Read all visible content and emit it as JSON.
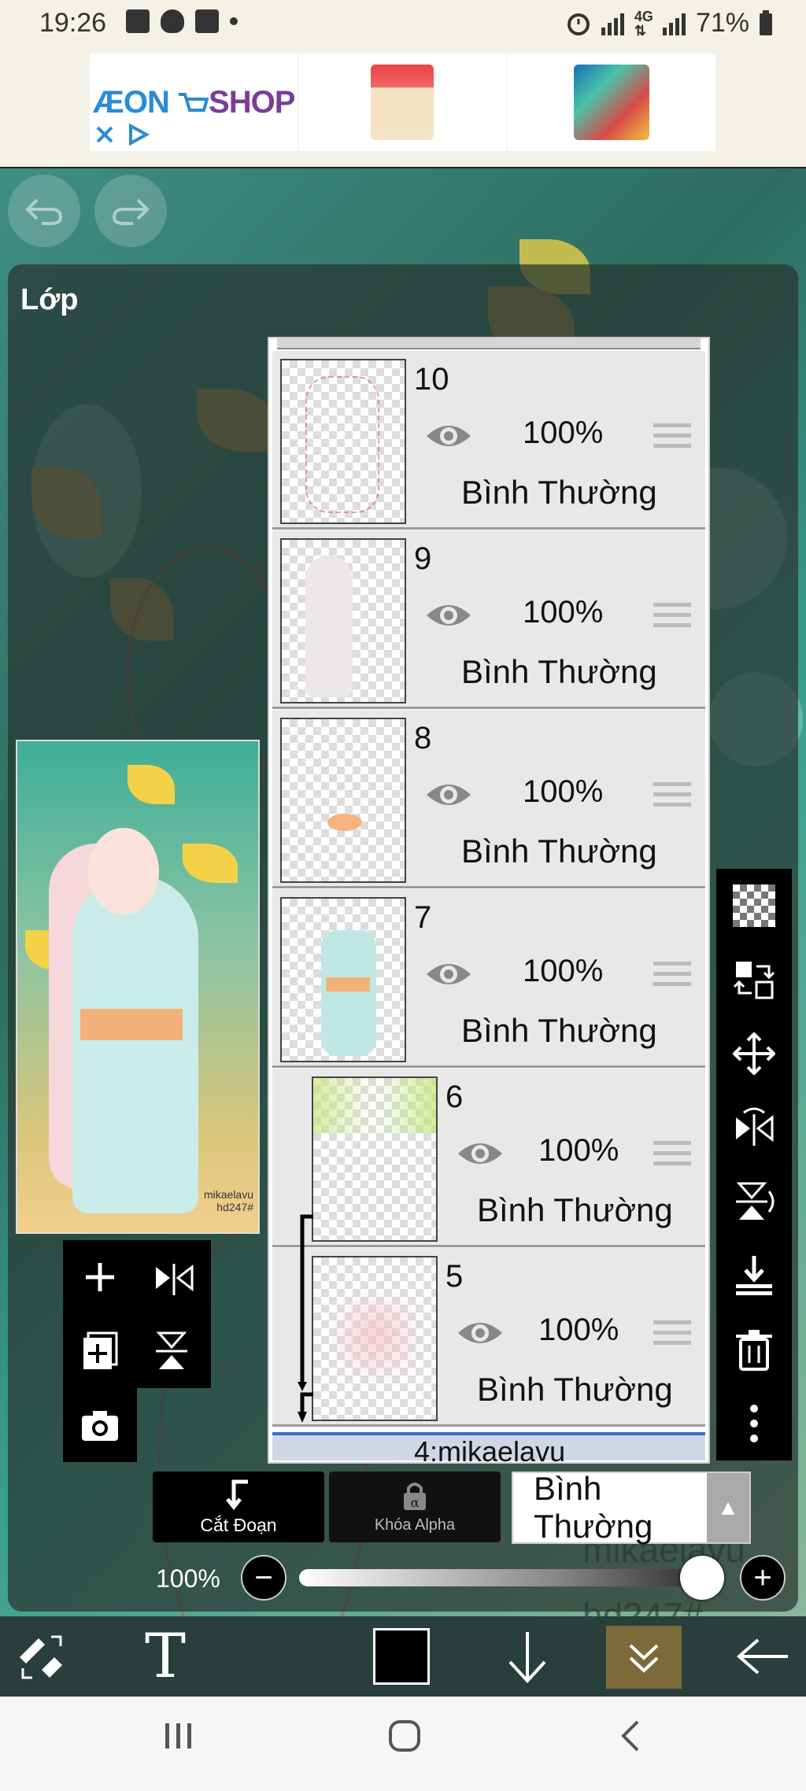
{
  "status_bar": {
    "time": "19:26",
    "left_icons": [
      "gallery-icon",
      "shield-icon",
      "facebook-icon",
      "dot-icon"
    ],
    "right_icons": [
      "alarm-icon",
      "signal-icon",
      "4g-icon",
      "signal-icon"
    ],
    "battery": "71%"
  },
  "ad": {
    "brand_left": "ÆON",
    "brand_right": "SHOP",
    "close_icon": "close-icon",
    "adchoices_icon": "adchoices-icon"
  },
  "layer_panel": {
    "title": "Lớp",
    "layers": [
      {
        "number": "10",
        "opacity": "100%",
        "blend": "Bình Thường",
        "clipped": false
      },
      {
        "number": "9",
        "opacity": "100%",
        "blend": "Bình Thường",
        "clipped": false
      },
      {
        "number": "8",
        "opacity": "100%",
        "blend": "Bình Thường",
        "clipped": false
      },
      {
        "number": "7",
        "opacity": "100%",
        "blend": "Bình Thường",
        "clipped": false
      },
      {
        "number": "6",
        "opacity": "100%",
        "blend": "Bình Thường",
        "clipped": true
      },
      {
        "number": "5",
        "opacity": "100%",
        "blend": "Bình Thường",
        "clipped": true
      }
    ],
    "partial_layer_label": "4:mikaelavu",
    "preview_signature": "mikaelavu\nhd247#"
  },
  "controls": {
    "clip_label": "Cắt Đoạn",
    "alpha_lock_label": "Khóa Alpha",
    "blend_mode": "Bình Thường",
    "opacity_label": "100%",
    "opacity_value": 1.0,
    "minus_label": "−",
    "plus_label": "+"
  },
  "canvas_text": {
    "watermark_1": "mikaelavu",
    "watermark_2": "hd247#"
  },
  "colors": {
    "current_color": "#000000",
    "active_layer_border": "#3a6fc4"
  }
}
